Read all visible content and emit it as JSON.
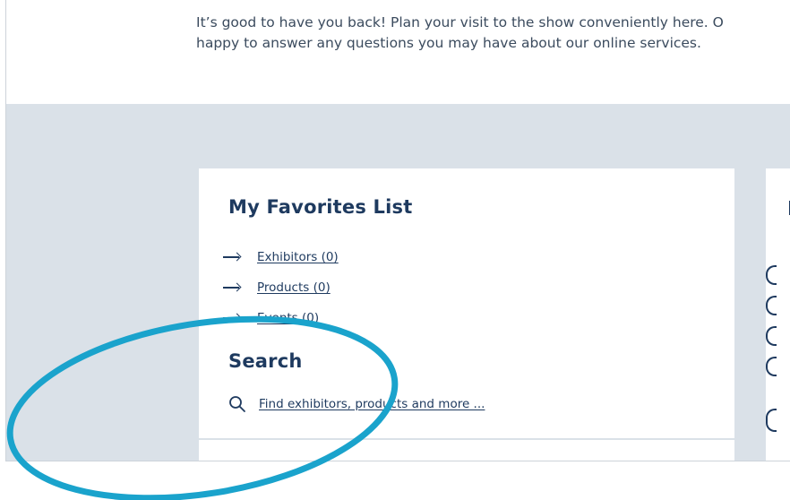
{
  "intro": {
    "line1": "It’s good to have you back! Plan your visit to the show conveniently here. O",
    "line2": "happy to answer any questions you may have about our online services."
  },
  "favorites": {
    "title": "My Favorites List",
    "items": [
      {
        "label": "Exhibitors (0)",
        "icon": "arrow-right-icon"
      },
      {
        "label": "Products (0)",
        "icon": "arrow-right-icon"
      },
      {
        "label": "Events (0)",
        "icon": "arrow-right-icon"
      }
    ]
  },
  "search": {
    "title": "Search",
    "link_label": "Find exhibitors, products and more ...",
    "icon": "search-icon"
  },
  "colors": {
    "primary_text": "#1e3a5f",
    "band_background": "#dae1e8",
    "highlight_ring": "#1aa3cc"
  }
}
